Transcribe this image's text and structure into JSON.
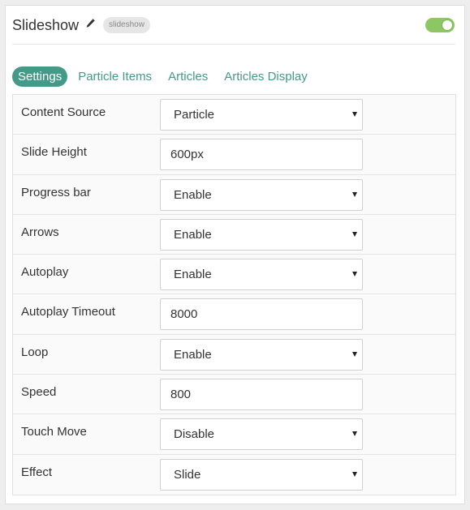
{
  "header": {
    "title": "Slideshow",
    "badge": "slideshow",
    "toggle_on": true
  },
  "tabs": [
    {
      "label": "Settings",
      "active": true
    },
    {
      "label": "Particle Items",
      "active": false
    },
    {
      "label": "Articles",
      "active": false
    },
    {
      "label": "Articles Display",
      "active": false
    }
  ],
  "settings": [
    {
      "label": "Content Source",
      "type": "select",
      "value": "Particle"
    },
    {
      "label": "Slide Height",
      "type": "text",
      "value": "600px"
    },
    {
      "label": "Progress bar",
      "type": "select",
      "value": "Enable"
    },
    {
      "label": "Arrows",
      "type": "select",
      "value": "Enable"
    },
    {
      "label": "Autoplay",
      "type": "select",
      "value": "Enable"
    },
    {
      "label": "Autoplay Timeout",
      "type": "text",
      "value": "8000"
    },
    {
      "label": "Loop",
      "type": "select",
      "value": "Enable"
    },
    {
      "label": "Speed",
      "type": "text",
      "value": "800"
    },
    {
      "label": "Touch Move",
      "type": "select",
      "value": "Disable"
    },
    {
      "label": "Effect",
      "type": "select",
      "value": "Slide"
    }
  ],
  "colors": {
    "accent": "#439a86",
    "toggle": "#8dc763"
  },
  "icons": {
    "edit": "pencil-icon",
    "dropdown": "caret-down-icon"
  }
}
